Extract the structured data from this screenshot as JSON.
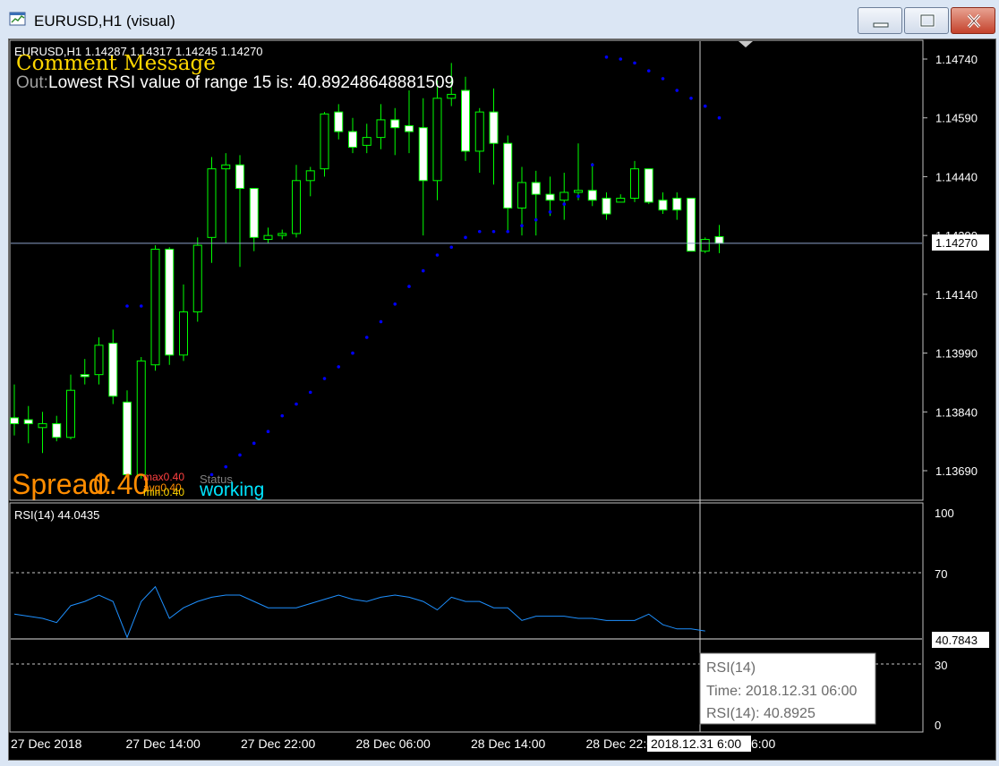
{
  "window": {
    "title": "EURUSD,H1 (visual)",
    "icons": {
      "app": "chart-window-icon",
      "minimize": "minimize-icon",
      "maximize": "maximize-icon",
      "close": "close-icon"
    }
  },
  "chart": {
    "header": "EURUSD,H1  1.14287 1.14317 1.14245 1.14270",
    "comment_title": "Comment Message",
    "comment_prefix": "Out:",
    "comment_line": "Lowest RSI value of range 15 is: 40.89248648881509",
    "spread_label": "Spread:",
    "spread_value": "0.40",
    "max_label": "max0.40",
    "avg_label": "avg0.40",
    "min_label": "min:0.40",
    "status_label": "Status",
    "status_value": "working",
    "price_axis": [
      "1.14740",
      "1.14590",
      "1.14440",
      "1.14290",
      "1.14140",
      "1.13990",
      "1.13840",
      "1.13690"
    ],
    "current_price": "1.14270",
    "colors": {
      "bull": "#ffffff",
      "outline": "#00ff00",
      "sar": "#0000ff",
      "grid": "#ffffff",
      "comment_title": "#ffd700",
      "spread": "#ff8c00",
      "working": "#00e5ff",
      "rsi_line": "#1e90ff"
    }
  },
  "rsi": {
    "header": "RSI(14) 44.0435",
    "axis": [
      "100",
      "70",
      "30",
      "0"
    ],
    "crosshair_value": "40.7843",
    "tooltip": {
      "name": "RSI(14)",
      "time": "Time: 2018.12.31 06:00",
      "value": "RSI(14): 40.8925"
    }
  },
  "time_axis": {
    "labels": [
      "27 Dec 2018",
      "27 Dec 14:00",
      "27 Dec 22:00",
      "28 Dec 06:00",
      "28 Dec 14:00",
      "28 Dec 22:00"
    ],
    "crosshair_label": "2018.12.31 6:00",
    "trailing_fragment": "6:00"
  },
  "chart_data": {
    "type": "candlestick",
    "instrument": "EURUSD",
    "timeframe": "H1",
    "ohlc": [
      {
        "o": 1.13825,
        "h": 1.1391,
        "l": 1.1378,
        "c": 1.1381
      },
      {
        "o": 1.1382,
        "h": 1.13855,
        "l": 1.1376,
        "c": 1.1381
      },
      {
        "o": 1.138,
        "h": 1.1384,
        "l": 1.13735,
        "c": 1.1381
      },
      {
        "o": 1.1381,
        "h": 1.1383,
        "l": 1.13765,
        "c": 1.13775
      },
      {
        "o": 1.13775,
        "h": 1.13935,
        "l": 1.1377,
        "c": 1.13895
      },
      {
        "o": 1.13935,
        "h": 1.13975,
        "l": 1.1391,
        "c": 1.1393
      },
      {
        "o": 1.13935,
        "h": 1.1403,
        "l": 1.1391,
        "c": 1.1401
      },
      {
        "o": 1.14015,
        "h": 1.1405,
        "l": 1.1386,
        "c": 1.1388
      },
      {
        "o": 1.13865,
        "h": 1.13895,
        "l": 1.1368,
        "c": 1.1368
      },
      {
        "o": 1.1368,
        "h": 1.1398,
        "l": 1.1367,
        "c": 1.1397
      },
      {
        "o": 1.1396,
        "h": 1.14265,
        "l": 1.13945,
        "c": 1.14255
      },
      {
        "o": 1.14255,
        "h": 1.1426,
        "l": 1.1396,
        "c": 1.13985
      },
      {
        "o": 1.13985,
        "h": 1.14165,
        "l": 1.1397,
        "c": 1.14095
      },
      {
        "o": 1.14095,
        "h": 1.14285,
        "l": 1.1407,
        "c": 1.14265
      },
      {
        "o": 1.14285,
        "h": 1.1449,
        "l": 1.1422,
        "c": 1.1446
      },
      {
        "o": 1.1446,
        "h": 1.145,
        "l": 1.1427,
        "c": 1.1447
      },
      {
        "o": 1.1447,
        "h": 1.14495,
        "l": 1.1421,
        "c": 1.1441
      },
      {
        "o": 1.1441,
        "h": 1.1441,
        "l": 1.1425,
        "c": 1.14285
      },
      {
        "o": 1.1428,
        "h": 1.1431,
        "l": 1.1427,
        "c": 1.1429
      },
      {
        "o": 1.1429,
        "h": 1.14305,
        "l": 1.1428,
        "c": 1.14295
      },
      {
        "o": 1.14295,
        "h": 1.1447,
        "l": 1.14285,
        "c": 1.1443
      },
      {
        "o": 1.1443,
        "h": 1.14465,
        "l": 1.1439,
        "c": 1.14455
      },
      {
        "o": 1.1446,
        "h": 1.14605,
        "l": 1.1444,
        "c": 1.146
      },
      {
        "o": 1.14605,
        "h": 1.14625,
        "l": 1.14535,
        "c": 1.14555
      },
      {
        "o": 1.14555,
        "h": 1.1459,
        "l": 1.145,
        "c": 1.14515
      },
      {
        "o": 1.1452,
        "h": 1.14575,
        "l": 1.145,
        "c": 1.1454
      },
      {
        "o": 1.1454,
        "h": 1.14625,
        "l": 1.1451,
        "c": 1.14585
      },
      {
        "o": 1.14585,
        "h": 1.14615,
        "l": 1.14495,
        "c": 1.14565
      },
      {
        "o": 1.1457,
        "h": 1.1466,
        "l": 1.145,
        "c": 1.14555
      },
      {
        "o": 1.14565,
        "h": 1.1464,
        "l": 1.1429,
        "c": 1.1443
      },
      {
        "o": 1.1443,
        "h": 1.14685,
        "l": 1.1438,
        "c": 1.1464
      },
      {
        "o": 1.1464,
        "h": 1.1473,
        "l": 1.1462,
        "c": 1.1465
      },
      {
        "o": 1.1466,
        "h": 1.14695,
        "l": 1.1448,
        "c": 1.14505
      },
      {
        "o": 1.14505,
        "h": 1.14615,
        "l": 1.1445,
        "c": 1.14605
      },
      {
        "o": 1.14605,
        "h": 1.14665,
        "l": 1.1442,
        "c": 1.14525
      },
      {
        "o": 1.14525,
        "h": 1.14545,
        "l": 1.143,
        "c": 1.1436
      },
      {
        "o": 1.1436,
        "h": 1.14465,
        "l": 1.1429,
        "c": 1.14425
      },
      {
        "o": 1.14425,
        "h": 1.14455,
        "l": 1.1429,
        "c": 1.14395
      },
      {
        "o": 1.14395,
        "h": 1.1444,
        "l": 1.1434,
        "c": 1.1438
      },
      {
        "o": 1.1438,
        "h": 1.1445,
        "l": 1.1433,
        "c": 1.144
      },
      {
        "o": 1.144,
        "h": 1.14525,
        "l": 1.1438,
        "c": 1.14405
      },
      {
        "o": 1.14405,
        "h": 1.14475,
        "l": 1.14365,
        "c": 1.1438
      },
      {
        "o": 1.14385,
        "h": 1.144,
        "l": 1.1433,
        "c": 1.14345
      },
      {
        "o": 1.14375,
        "h": 1.14395,
        "l": 1.1438,
        "c": 1.14385
      },
      {
        "o": 1.14385,
        "h": 1.1448,
        "l": 1.14375,
        "c": 1.1446
      },
      {
        "o": 1.1446,
        "h": 1.1446,
        "l": 1.1437,
        "c": 1.14375
      },
      {
        "o": 1.1438,
        "h": 1.144,
        "l": 1.14345,
        "c": 1.14355
      },
      {
        "o": 1.14385,
        "h": 1.144,
        "l": 1.1433,
        "c": 1.14355
      },
      {
        "o": 1.14385,
        "h": 1.14385,
        "l": 1.1425,
        "c": 1.1425
      },
      {
        "o": 1.1425,
        "h": 1.14285,
        "l": 1.14245,
        "c": 1.1428
      },
      {
        "o": 1.14287,
        "h": 1.14317,
        "l": 1.14245,
        "c": 1.1427
      }
    ],
    "sar": [
      null,
      null,
      null,
      null,
      null,
      null,
      null,
      null,
      1.1411,
      1.1411,
      null,
      null,
      null,
      null,
      1.1368,
      1.137,
      1.1373,
      1.1376,
      1.1379,
      1.1383,
      1.1386,
      1.1389,
      1.13925,
      1.13955,
      1.1399,
      1.1403,
      1.1407,
      1.14115,
      1.1416,
      1.142,
      1.1424,
      1.1426,
      1.14285,
      1.143,
      1.143,
      1.143,
      1.14315,
      1.1433,
      1.1435,
      1.1437,
      1.1439,
      1.1447,
      1.14745,
      1.1474,
      1.1473,
      1.1471,
      1.1469,
      1.1466,
      1.1464,
      1.1462,
      1.1459
    ],
    "rsi": [
      52,
      51,
      50,
      48,
      56,
      58,
      61,
      58,
      41,
      58,
      65,
      50,
      55,
      58,
      60,
      61,
      61,
      58,
      55,
      55,
      55,
      57,
      59,
      61,
      59,
      58,
      60,
      61,
      60,
      58,
      54,
      60,
      58,
      58,
      55,
      55,
      49,
      51,
      51,
      51,
      50,
      50,
      49,
      49,
      49,
      52,
      47,
      45,
      45,
      44,
      null,
      null
    ],
    "rsi_axis_range": [
      0,
      100
    ],
    "rsi_levels": [
      70,
      30
    ],
    "price_range": [
      1.1364,
      1.1479
    ]
  }
}
